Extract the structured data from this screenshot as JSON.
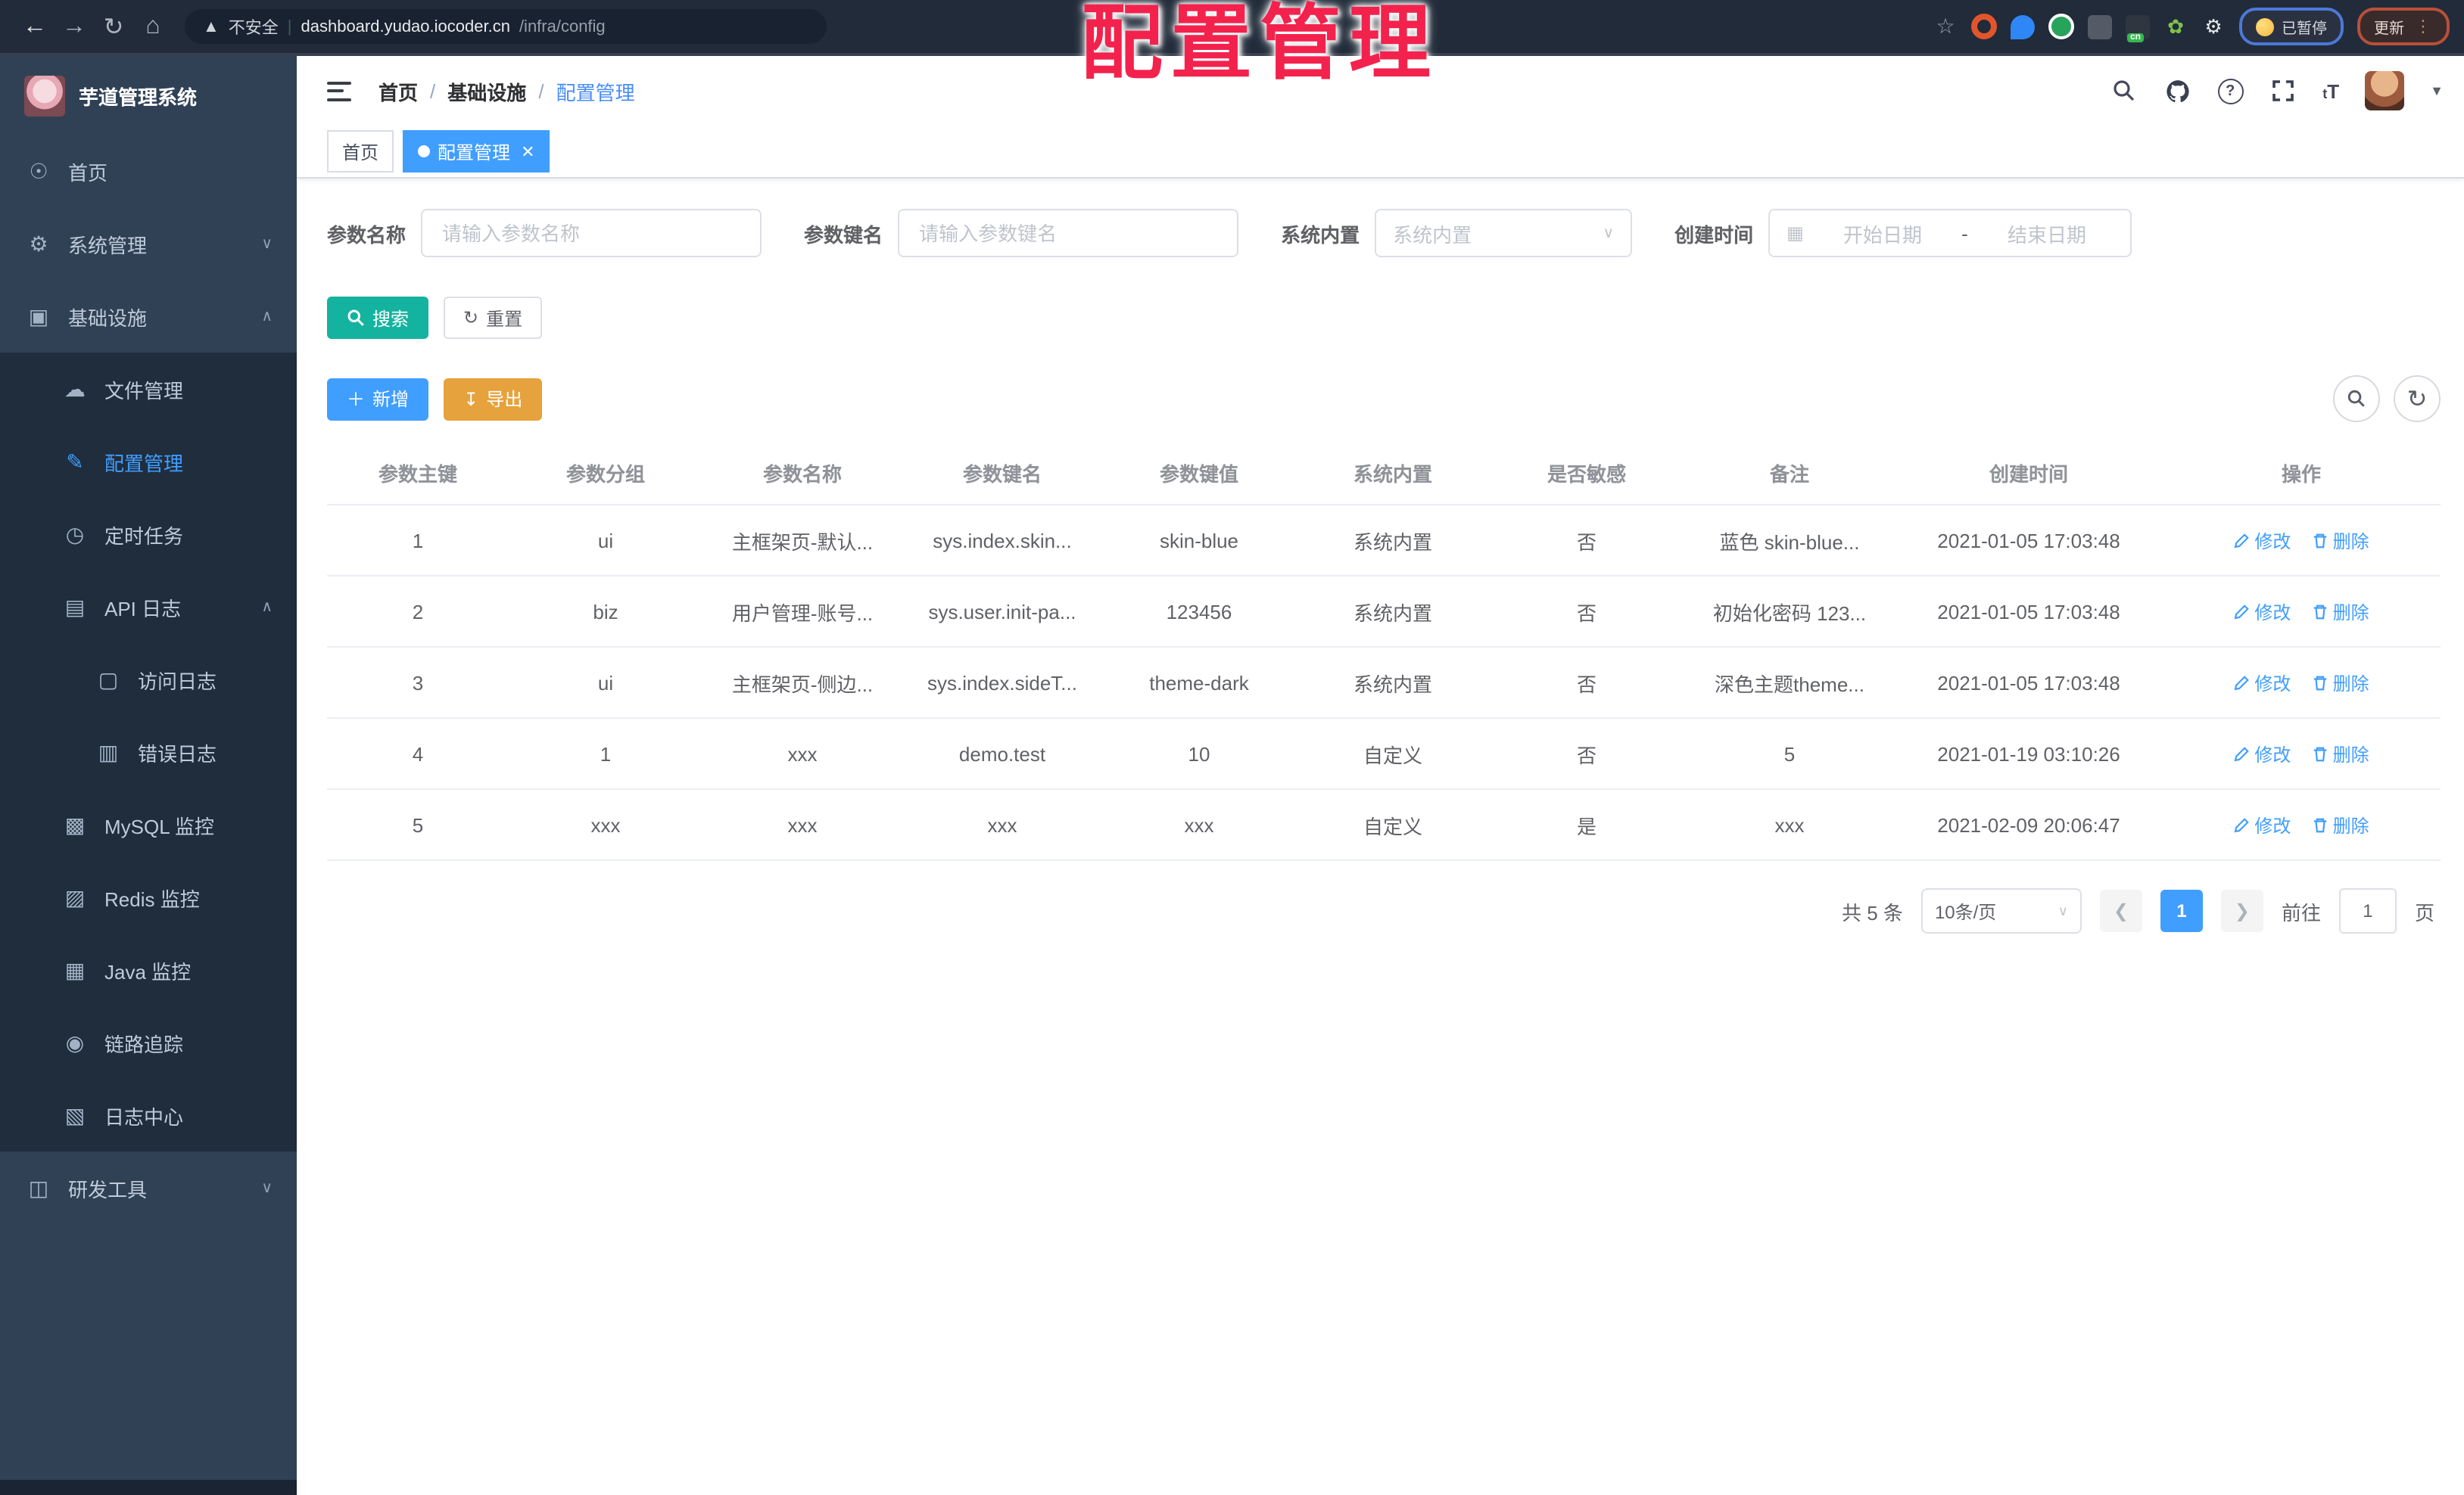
{
  "annotation": {
    "text": "配置管理",
    "color": "#F3224D"
  },
  "browser": {
    "security_label": "不安全",
    "url_host": "dashboard.yudao.iocoder.cn",
    "url_path": "/infra/config",
    "paused_badge": "已暂停",
    "update_button": "更新",
    "cn_badge": "cn"
  },
  "sidebar": {
    "app_title": "芋道管理系统",
    "items": [
      {
        "label": "首页"
      },
      {
        "label": "系统管理"
      },
      {
        "label": "基础设施"
      },
      {
        "label": "文件管理"
      },
      {
        "label": "配置管理"
      },
      {
        "label": "定时任务"
      },
      {
        "label": "API 日志"
      },
      {
        "label": "访问日志"
      },
      {
        "label": "错误日志"
      },
      {
        "label": "MySQL 监控"
      },
      {
        "label": "Redis 监控"
      },
      {
        "label": "Java 监控"
      },
      {
        "label": "链路追踪"
      },
      {
        "label": "日志中心"
      },
      {
        "label": "研发工具"
      }
    ]
  },
  "header": {
    "breadcrumb": {
      "home": "首页",
      "parent": "基础设施",
      "current": "配置管理"
    }
  },
  "tags": {
    "home": "首页",
    "current": "配置管理"
  },
  "filters": {
    "name_label": "参数名称",
    "name_placeholder": "请输入参数名称",
    "key_label": "参数键名",
    "key_placeholder": "请输入参数键名",
    "type_label": "系统内置",
    "type_placeholder": "系统内置",
    "date_label": "创建时间",
    "date_start_placeholder": "开始日期",
    "date_separator": "-",
    "date_end_placeholder": "结束日期"
  },
  "actions": {
    "search": "搜索",
    "reset": "重置",
    "create": "新增",
    "export": "导出"
  },
  "table": {
    "columns": [
      "参数主键",
      "参数分组",
      "参数名称",
      "参数键名",
      "参数键值",
      "系统内置",
      "是否敏感",
      "备注",
      "创建时间",
      "操作"
    ],
    "row_actions": {
      "edit": "修改",
      "delete": "删除"
    },
    "rows": [
      {
        "cells": [
          "1",
          "ui",
          "主框架页-默认...",
          "sys.index.skin...",
          "skin-blue",
          "系统内置",
          "否",
          "蓝色 skin-blue...",
          "2021-01-05 17:03:48"
        ]
      },
      {
        "cells": [
          "2",
          "biz",
          "用户管理-账号...",
          "sys.user.init-pa...",
          "123456",
          "系统内置",
          "否",
          "初始化密码 123...",
          "2021-01-05 17:03:48"
        ]
      },
      {
        "cells": [
          "3",
          "ui",
          "主框架页-侧边...",
          "sys.index.sideT...",
          "theme-dark",
          "系统内置",
          "否",
          "深色主题theme...",
          "2021-01-05 17:03:48"
        ]
      },
      {
        "cells": [
          "4",
          "1",
          "xxx",
          "demo.test",
          "10",
          "自定义",
          "否",
          "5",
          "2021-01-19 03:10:26"
        ]
      },
      {
        "cells": [
          "5",
          "xxx",
          "xxx",
          "xxx",
          "xxx",
          "自定义",
          "是",
          "xxx",
          "2021-02-09 20:06:47"
        ]
      }
    ]
  },
  "pagination": {
    "total": "共 5 条",
    "page_size": "10条/页",
    "current_page": "1",
    "goto_label": "前往",
    "page_unit": "页"
  },
  "colors": {
    "accent": "#409EFF",
    "search_button": "#14B3A0",
    "export_button": "#E6A23C",
    "sidebar_bg": "#304156",
    "submenu_bg": "#1F2D3D",
    "chrome_bg": "#212B39"
  }
}
